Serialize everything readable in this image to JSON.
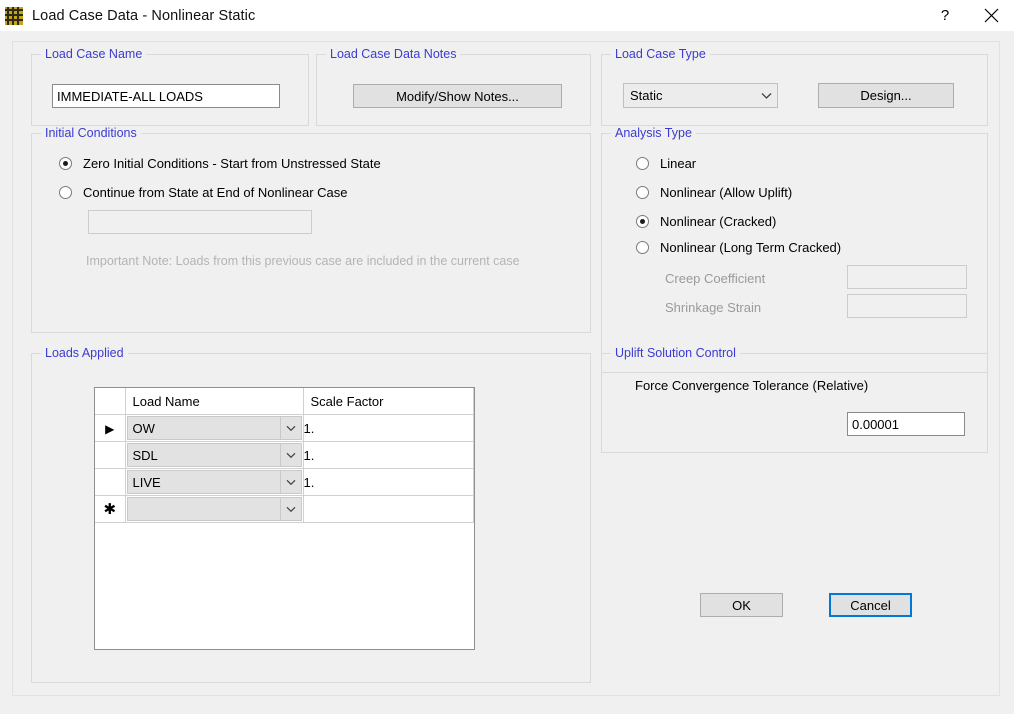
{
  "window": {
    "title": "Load Case Data - Nonlinear Static",
    "icon": "grid-mesh-icon",
    "help_label": "?",
    "close_label": "✕"
  },
  "load_case_name": {
    "group_label": "Load Case Name",
    "value": "IMMEDIATE-ALL LOADS"
  },
  "notes": {
    "group_label": "Load Case Data Notes",
    "button_label": "Modify/Show Notes..."
  },
  "load_case_type": {
    "group_label": "Load Case Type",
    "selected": "Static",
    "options": [
      "Static"
    ],
    "design_button_label": "Design..."
  },
  "initial_conditions": {
    "group_label": "Initial Conditions",
    "options": [
      {
        "label": "Zero Initial Conditions - Start from Unstressed State",
        "checked": true
      },
      {
        "label": "Continue from State at End of Nonlinear Case",
        "checked": false
      }
    ],
    "case_field_value": "",
    "note": "Important Note:  Loads from this previous case are included in the current case"
  },
  "analysis_type": {
    "group_label": "Analysis Type",
    "options": [
      {
        "label": "Linear",
        "checked": false
      },
      {
        "label": "Nonlinear (Allow Uplift)",
        "checked": false
      },
      {
        "label": "Nonlinear (Cracked)",
        "checked": true
      },
      {
        "label": "Nonlinear (Long Term Cracked)",
        "checked": false
      }
    ],
    "creep_label": "Creep Coefficient",
    "creep_value": "",
    "shrinkage_label": "Shrinkage Strain",
    "shrinkage_value": ""
  },
  "loads_applied": {
    "group_label": "Loads Applied",
    "columns": [
      "",
      "Load Name",
      "Scale Factor"
    ],
    "rows": [
      {
        "marker": "▶",
        "load_name": "OW",
        "scale_factor": "1."
      },
      {
        "marker": "",
        "load_name": "SDL",
        "scale_factor": "1."
      },
      {
        "marker": "",
        "load_name": "LIVE",
        "scale_factor": "1."
      },
      {
        "marker": "✱",
        "load_name": "",
        "scale_factor": ""
      }
    ]
  },
  "uplift": {
    "group_label": "Uplift Solution Control",
    "tolerance_label": "Force Convergence Tolerance (Relative)",
    "tolerance_value": "0.00001"
  },
  "footer": {
    "ok_label": "OK",
    "cancel_label": "Cancel"
  },
  "colors": {
    "group_title": "#3b3bd0",
    "dialog_bg": "#f0f0f0",
    "focus_border": "#0078d7",
    "disabled_text": "#9a9a9a"
  }
}
